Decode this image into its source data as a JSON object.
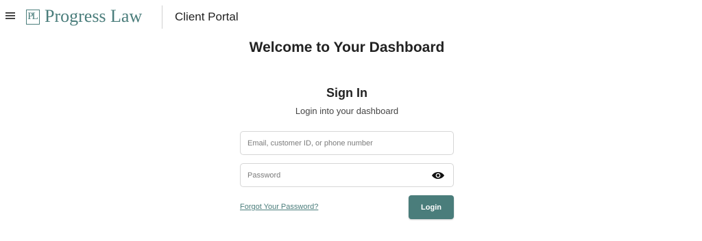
{
  "header": {
    "menu_icon": "hamburger-menu-icon",
    "logo_mark": "PL",
    "logo_text": "Progress Law",
    "portal_title": "Client Portal"
  },
  "page": {
    "title": "Welcome to Your Dashboard"
  },
  "signin": {
    "title": "Sign In",
    "subtitle": "Login into your dashboard",
    "email": {
      "value": "",
      "placeholder": "Email, customer ID, or phone number"
    },
    "password": {
      "value": "",
      "placeholder": "Password",
      "toggle_icon": "eye-icon"
    },
    "forgot_label": "Forgot Your Password?",
    "login_label": "Login"
  },
  "colors": {
    "brand": "#4a7d7b",
    "text": "#222222",
    "field_border": "#d6d6d6",
    "background": "#ffffff"
  }
}
